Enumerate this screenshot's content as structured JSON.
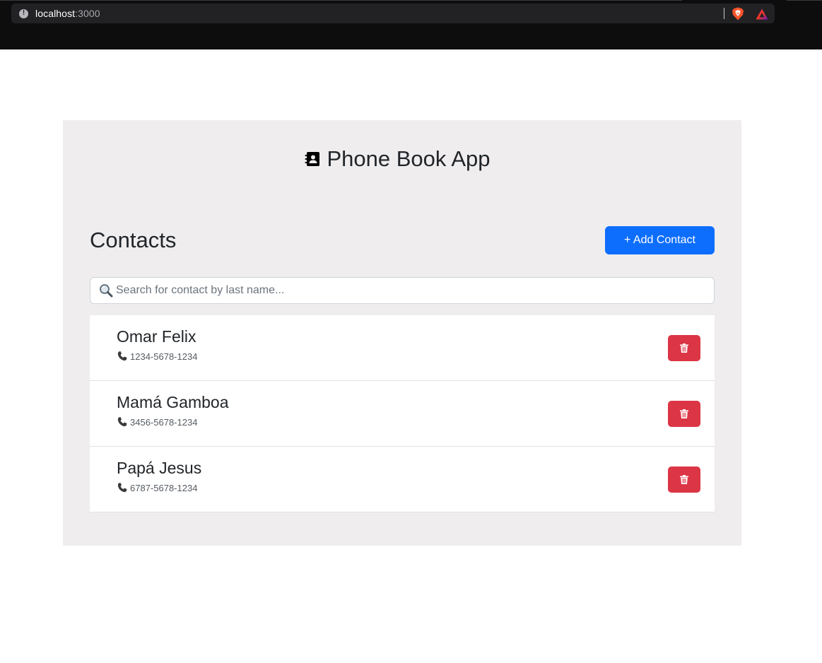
{
  "browser": {
    "url_host": "localhost",
    "url_port": ":3000"
  },
  "app": {
    "title": "Phone Book App"
  },
  "contacts_section": {
    "heading": "Contacts",
    "add_button_label": "+ Add Contact"
  },
  "search": {
    "placeholder": "Search for contact by last name...",
    "value": ""
  },
  "contacts": [
    {
      "name": "Omar Felix",
      "phone": "1234-5678-1234"
    },
    {
      "name": "Mamá Gamboa",
      "phone": "3456-5678-1234"
    },
    {
      "name": "Papá Jesus",
      "phone": "6787-5678-1234"
    }
  ],
  "colors": {
    "primary": "#0d6efd",
    "danger": "#dc3545",
    "panel_bg": "#efedee"
  }
}
